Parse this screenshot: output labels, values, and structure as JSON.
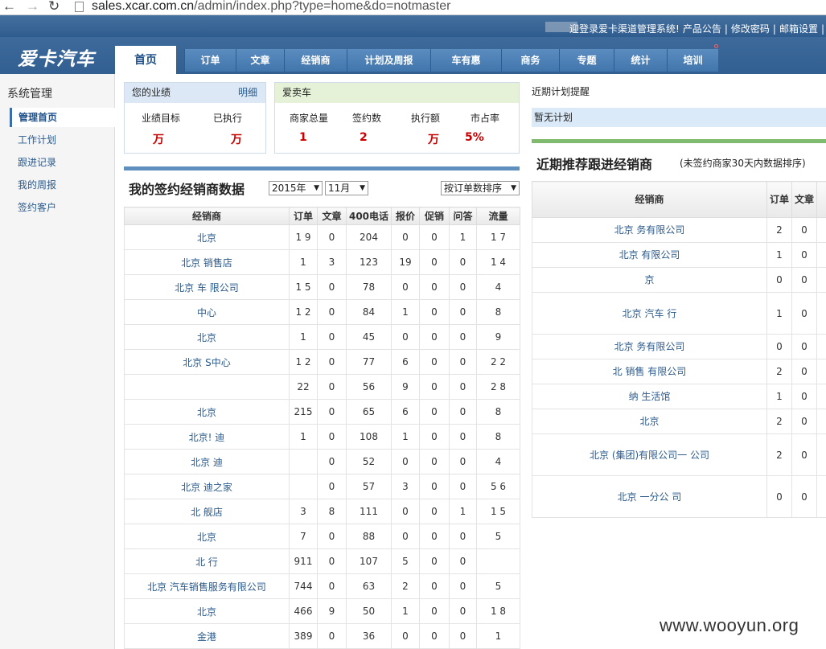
{
  "browser": {
    "url_host": "sales.xcar.com.cn",
    "url_path": "/admin/index.php?type=home&do=notmaster"
  },
  "topstrip": {
    "links": [
      "迎登录爱卡渠道管理系统!",
      "产品公告",
      "|",
      "修改密码",
      "|",
      "邮箱设置",
      "|"
    ]
  },
  "brand": {
    "logo": "爱卡汽车"
  },
  "nav": {
    "items": [
      "首页",
      "订单",
      "文章",
      "经销商",
      "计划及周报",
      "车有惠",
      "商务",
      "专题",
      "统计",
      "培训"
    ],
    "active": "首页"
  },
  "sidebar": {
    "title": "系统管理",
    "items": [
      "管理首页",
      "工作计划",
      "跟进记录",
      "我的周报",
      "签约客户"
    ],
    "active": "管理首页"
  },
  "perf_box": {
    "title": "您的业绩",
    "link": "明细",
    "target_label": "业绩目标",
    "target_value": "万",
    "done_label": "已执行",
    "done_value": "万"
  },
  "aimai_box": {
    "title": "爱卖车",
    "cols": [
      {
        "label": "商家总量",
        "value": "1"
      },
      {
        "label": "签约数",
        "value": "2"
      },
      {
        "label": "执行额",
        "value": "万"
      },
      {
        "label": "市占率",
        "value": "5%"
      }
    ]
  },
  "plan": {
    "title": "近期计划提醒",
    "empty": "暂无计划"
  },
  "dealer_section": {
    "title": "我的签约经销商数据",
    "year": "2015年",
    "month": "11月",
    "sort": "按订单数排序"
  },
  "dealer_table": {
    "headers": [
      "经销商",
      "订单",
      "文章",
      "400电话",
      "报价",
      "促销",
      "问答",
      "流量"
    ],
    "rows": [
      [
        "北京  ",
        "1 9",
        "0",
        "204",
        "0",
        "0",
        "1",
        "1  7"
      ],
      [
        "北京     销售店",
        "1 ",
        "3",
        "123",
        "19",
        "0",
        "0",
        "1  4"
      ],
      [
        "北京     车 限公司",
        "1 5",
        "0",
        "78",
        "0",
        "0",
        "0",
        "4"
      ],
      [
        "   中心",
        "1 2",
        "0",
        "84",
        "1",
        "0",
        "0",
        "8  "
      ],
      [
        "北京  ",
        "1 ",
        "0",
        "45",
        "0",
        "0",
        "0",
        "9"
      ],
      [
        "北京   S中心",
        "1 2",
        "0",
        "77",
        "6",
        "0",
        "0",
        "2  2"
      ],
      [
        "  ",
        "22",
        "0",
        "56",
        "9",
        "0",
        "0",
        "2  8"
      ],
      [
        "北京  ",
        "215",
        "0",
        "65",
        "6",
        "0",
        "0",
        "8"
      ],
      [
        "北京!  迪",
        "1 ",
        "0",
        "108",
        "1",
        "0",
        "0",
        "8"
      ],
      [
        "北京   迪",
        "",
        "0",
        "52",
        "0",
        "0",
        "0",
        "4"
      ],
      [
        "北京  迪之家",
        "",
        "0",
        "57",
        "3",
        "0",
        "0",
        "5 6"
      ],
      [
        "北  舰店",
        "3",
        "8",
        "111",
        "0",
        "0",
        "1",
        "1  5"
      ],
      [
        "北京  ",
        "7",
        "0",
        "88",
        "0",
        "0",
        "0",
        "5"
      ],
      [
        "北  行",
        "911",
        "0",
        "107",
        "5",
        "0",
        "0",
        ""
      ],
      [
        "北京   汽车销售服务有限公司",
        "744",
        "0",
        "63",
        "2",
        "0",
        "0",
        "  5"
      ],
      [
        "北京  ",
        "466",
        "9",
        "50",
        "1",
        "0",
        "0",
        "1  8"
      ],
      [
        "金港  ",
        "389",
        "0",
        "36",
        "0",
        "0",
        "0",
        "1"
      ]
    ]
  },
  "recommend": {
    "title": "近期推荐跟进经销商",
    "note": "(未签约商家30天内数据排序)"
  },
  "recommend_table": {
    "headers": [
      "经销商",
      "订单",
      "文章"
    ],
    "rows": [
      [
        "北京   务有限公司",
        "2",
        "0"
      ],
      [
        "北京   有限公司",
        "1",
        "0"
      ],
      [
        "  京",
        "0",
        "0"
      ],
      [
        "北京   汽车 行",
        "1",
        "0"
      ],
      [
        "北京   务有限公司",
        "0",
        "0"
      ],
      [
        "北   销售 有限公司",
        "2",
        "0"
      ],
      [
        "纳   生活馆",
        "1",
        "0"
      ],
      [
        "  北京  ",
        "2",
        "0"
      ],
      [
        "北京   (集团)有限公司一 公司",
        "2",
        "0"
      ],
      [
        "北京   一分公 司",
        "0",
        "0"
      ]
    ]
  },
  "watermark": "www.wooyun.org"
}
